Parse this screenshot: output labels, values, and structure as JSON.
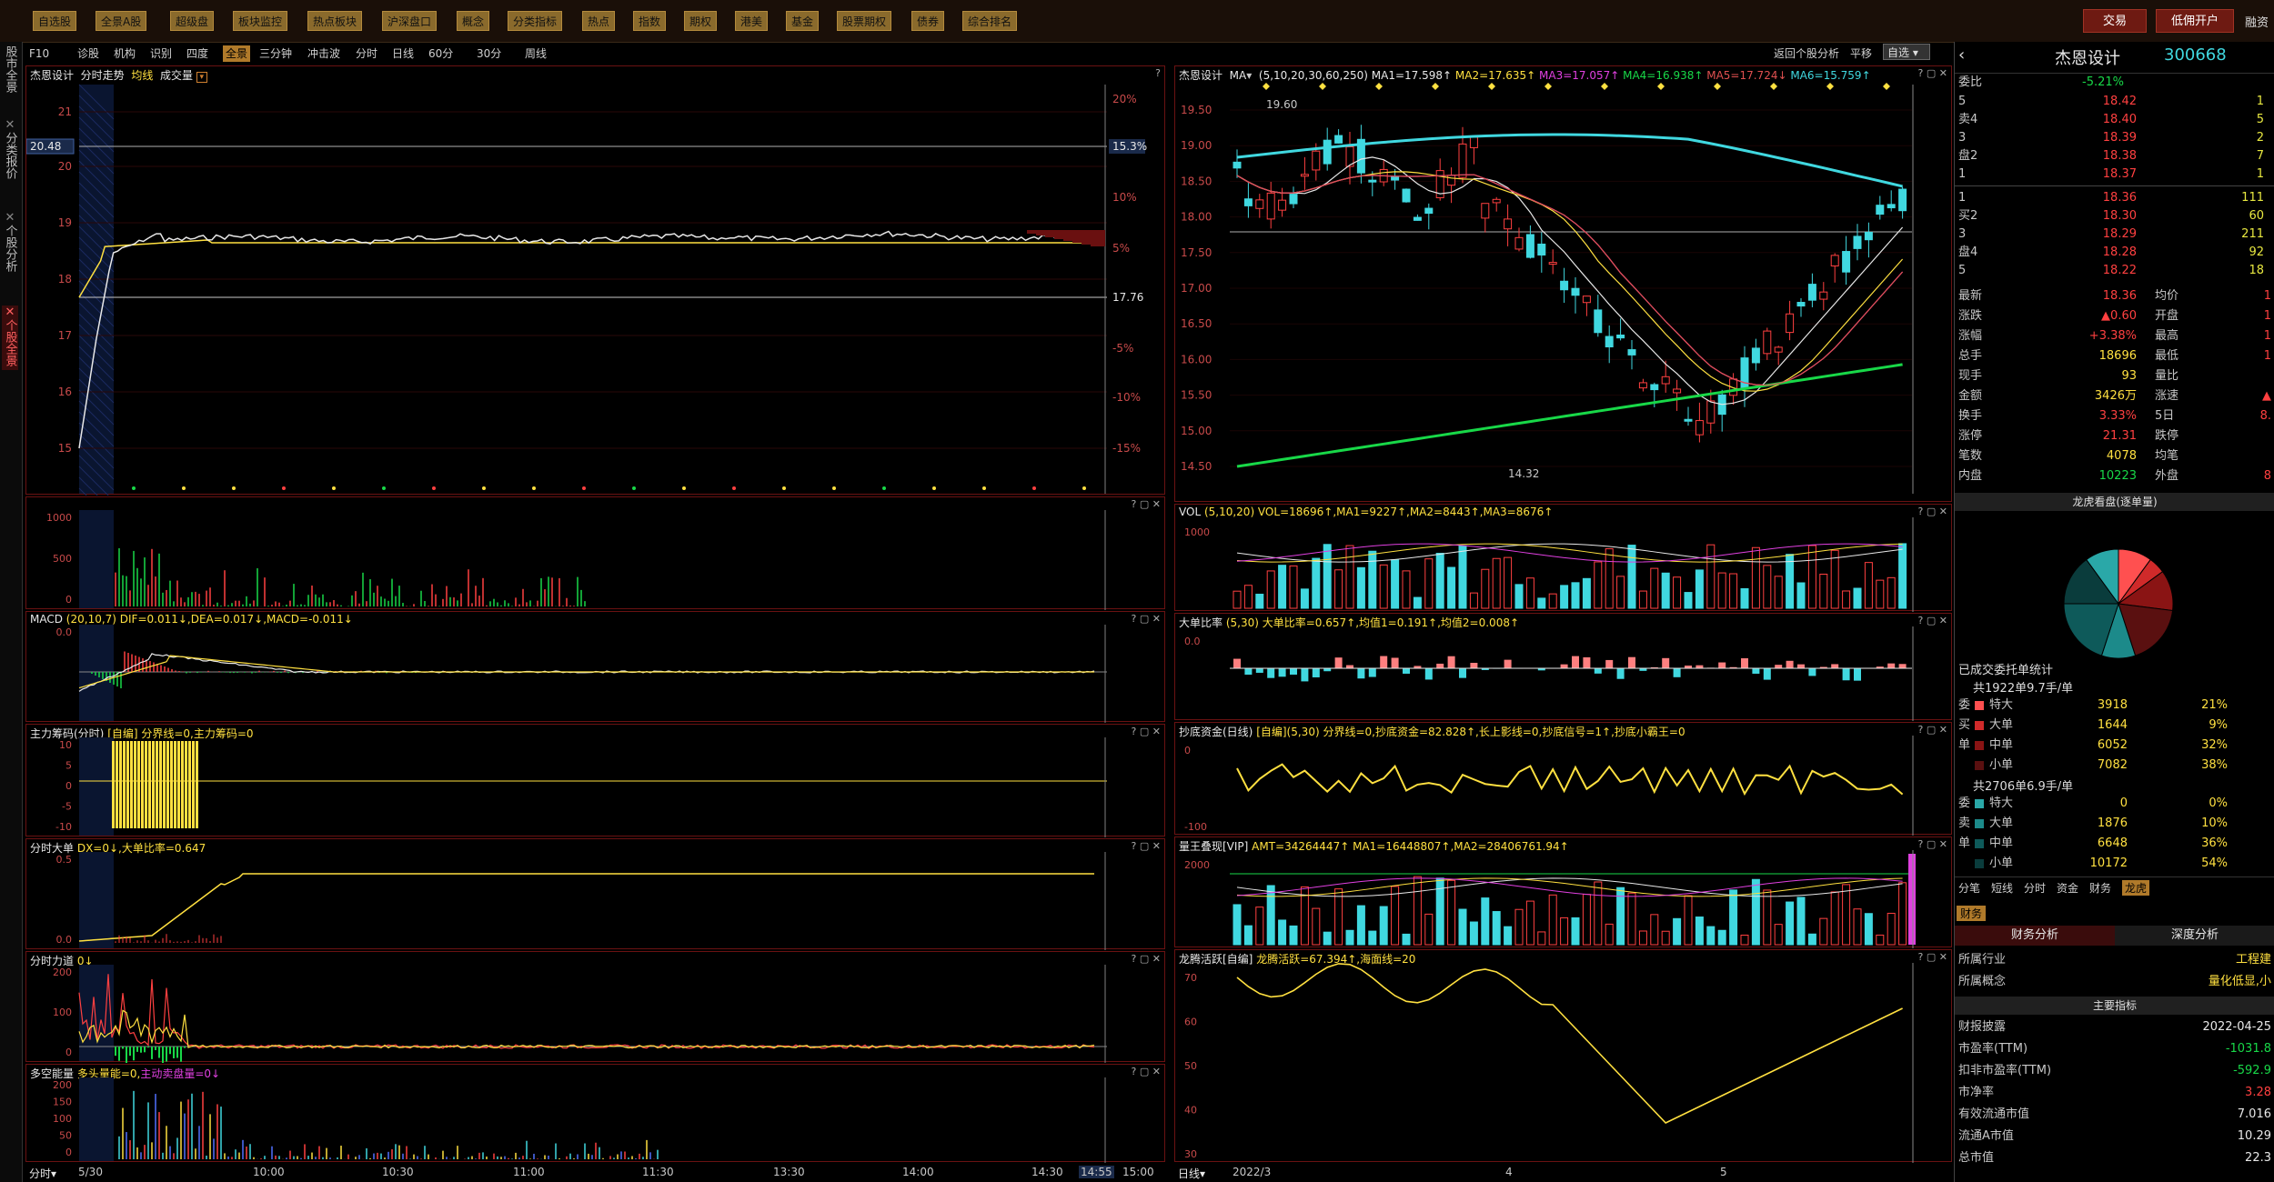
{
  "topbar": {
    "buttons": [
      "自选股",
      "全景A股",
      "超级盘",
      "板块监控",
      "热点板块",
      "沪深盘口",
      "概念",
      "分类指标",
      "热点",
      "指数",
      "期权",
      "港美",
      "基金",
      "股票期权",
      "债券",
      "综合排名"
    ],
    "trade_label": "交易",
    "open_account_label": "低佣开户",
    "misc": "融资"
  },
  "left_rail": [
    "股市全景",
    "分类报价",
    "个股分析",
    "个股全景"
  ],
  "toolbar": {
    "items": [
      "F10",
      "诊股",
      "机构",
      "识别",
      "四度",
      "全景",
      "三分钟",
      "冲击波",
      "分时",
      "日线",
      "60分",
      "30分",
      "周线"
    ],
    "active": "全景",
    "right": {
      "back": "返回个股分析",
      "flat": "平移",
      "watch": "自选"
    }
  },
  "intraday": {
    "title": "杰恩设计",
    "subtitle": "分时走势",
    "avg_label": "均线",
    "volume_label": "成交量",
    "yaxis": [
      "21",
      "20",
      "19",
      "18",
      "17",
      "16",
      "15"
    ],
    "pct_axis": [
      "20%",
      "15.3%",
      "10%",
      "5%",
      "17.76",
      "-5%",
      "-10%",
      "-15%"
    ],
    "price_marker": "20.48",
    "time_axis": [
      "5/30",
      "10:00",
      "10:30",
      "11:00",
      "11:30",
      "13:30",
      "14:00",
      "14:30",
      "14:55",
      "15:00"
    ],
    "footer_label": "分时",
    "subpanels": [
      {
        "title": "",
        "yaxis": [
          "1000",
          "500",
          "0"
        ]
      },
      {
        "title": "MACD",
        "info": "(20,10,7) DIF=0.011↓,DEA=0.017↓,MACD=-0.011↓",
        "yaxis": [
          "0.0"
        ]
      },
      {
        "title": "主力筹码(分时)",
        "info": "[自编] 分界线=0,主力筹码=0",
        "yaxis": [
          "10",
          "5",
          "0",
          "-5",
          "-10"
        ]
      },
      {
        "title": "分时大单",
        "info": "DX=0↓,大单比率=0.647",
        "yaxis": [
          "0.5",
          "0.0"
        ]
      },
      {
        "title": "分时力道",
        "info": "0↓",
        "yaxis": [
          "200",
          "100",
          "0"
        ]
      },
      {
        "title": "多空能量",
        "info": "多头量能=0,",
        "info2": "主动卖盘量=0↓",
        "yaxis": [
          "200",
          "150",
          "100",
          "50",
          "0"
        ]
      }
    ]
  },
  "daily": {
    "title": "杰恩设计",
    "ma_label": "MA",
    "ma_params": "(5,10,20,30,60,250)",
    "ma_values": [
      {
        "text": "MA1=17.598↑",
        "color": "#e8e8e8"
      },
      {
        "text": "MA2=17.635↑",
        "color": "#ffe040"
      },
      {
        "text": "MA3=17.057↑",
        "color": "#e040e0"
      },
      {
        "text": "MA4=16.938↑",
        "color": "#18d848"
      },
      {
        "text": "MA5=17.724↓",
        "color": "#e05050"
      },
      {
        "text": "MA6=15.759↑",
        "color": "#40d8e0"
      }
    ],
    "yaxis": [
      "19.50",
      "19.00",
      "18.50",
      "18.00",
      "17.50",
      "17.00",
      "16.50",
      "16.00",
      "15.50",
      "15.00",
      "14.50"
    ],
    "high_label": "19.60",
    "low_label": "14.32",
    "time_axis": [
      "2022/3",
      "4",
      "5"
    ],
    "footer_label": "日线",
    "subpanels": [
      {
        "title": "VOL",
        "info": "(5,10,20) VOL=18696↑,MA1=9227↑,MA2=8443↑,MA3=8676↑",
        "yaxis": [
          "1000"
        ]
      },
      {
        "title": "大单比率",
        "info": "(5,30) 大单比率=0.657↑,均值1=0.191↑,均值2=0.008↑",
        "yaxis": [
          "0.0"
        ]
      },
      {
        "title": "抄底资金(日线)",
        "info": "[自编](5,30) 分界线=0,抄底资金=82.828↑,长上影线=0,抄底信号=1↑,抄底小霸王=0",
        "yaxis": [
          "0",
          "-100"
        ]
      },
      {
        "title": "量王叠现[VIP]",
        "info": "AMT=34264447↑ MA1=16448807↑,MA2=28406761.94↑",
        "yaxis": [
          "2000"
        ]
      },
      {
        "title": "龙腾活跃[自编]",
        "info": "龙腾活跃=67.394↑,海面线=20",
        "yaxis": [
          "70",
          "60",
          "50",
          "40",
          "30"
        ]
      }
    ]
  },
  "quote": {
    "name": "杰恩设计",
    "code": "300668",
    "webi_label": "委比",
    "webi_value": "-5.21%",
    "asks": [
      {
        "label": "5",
        "price": "18.42",
        "vol": "1"
      },
      {
        "label": "卖4",
        "price": "18.40",
        "vol": "5"
      },
      {
        "label": "3",
        "price": "18.39",
        "vol": "2"
      },
      {
        "label": "盘2",
        "price": "18.38",
        "vol": "7"
      },
      {
        "label": "1",
        "price": "18.37",
        "vol": "1"
      }
    ],
    "bids": [
      {
        "label": "1",
        "price": "18.36",
        "vol": "111"
      },
      {
        "label": "买2",
        "price": "18.30",
        "vol": "60"
      },
      {
        "label": "3",
        "price": "18.29",
        "vol": "211"
      },
      {
        "label": "盘4",
        "price": "18.28",
        "vol": "92"
      },
      {
        "label": "5",
        "price": "18.22",
        "vol": "18"
      }
    ],
    "stats": [
      {
        "k1": "最新",
        "v1": "18.36",
        "k2": "均价",
        "v2": "1"
      },
      {
        "k1": "涨跌",
        "v1": "▲0.60",
        "k2": "开盘",
        "v2": "1"
      },
      {
        "k1": "涨幅",
        "v1": "+3.38%",
        "k2": "最高",
        "v2": "1"
      },
      {
        "k1": "总手",
        "v1": "18696",
        "k2": "最低",
        "v2": "1"
      },
      {
        "k1": "现手",
        "v1": "93",
        "k2": "量比",
        "v2": ""
      },
      {
        "k1": "金额",
        "v1": "3426万",
        "k2": "涨速",
        "v2": "▲"
      },
      {
        "k1": "换手",
        "v1": "3.33%",
        "k2": "5日",
        "v2": "8."
      },
      {
        "k1": "涨停",
        "v1": "21.31",
        "k2": "跌停",
        "v2": ""
      },
      {
        "k1": "笔数",
        "v1": "4078",
        "k2": "均笔",
        "v2": ""
      },
      {
        "k1": "内盘",
        "v1": "10223",
        "k2": "外盘",
        "v2": "8"
      }
    ],
    "lhb_title": "龙虎看盘(逐单量)",
    "deal_title": "已成交委托单统计",
    "buy_summary": "共1922单9.7手/单",
    "sell_summary": "共2706单6.9手/单",
    "buy_rows": [
      {
        "side": "委",
        "name": "特大",
        "vol": "3918",
        "pct": "21%"
      },
      {
        "side": "买",
        "name": "大单",
        "vol": "1644",
        "pct": "9%"
      },
      {
        "side": "单",
        "name": "中单",
        "vol": "6052",
        "pct": "32%"
      },
      {
        "side": "",
        "name": "小单",
        "vol": "7082",
        "pct": "38%"
      }
    ],
    "sell_rows": [
      {
        "side": "委",
        "name": "特大",
        "vol": "0",
        "pct": "0%"
      },
      {
        "side": "卖",
        "name": "大单",
        "vol": "1876",
        "pct": "10%"
      },
      {
        "side": "单",
        "name": "中单",
        "vol": "6648",
        "pct": "36%"
      },
      {
        "side": "",
        "name": "小单",
        "vol": "10172",
        "pct": "54%"
      }
    ],
    "tabs": [
      "分笔",
      "短线",
      "分时",
      "资金",
      "财务",
      "龙虎"
    ],
    "active_tab": "龙虎",
    "finance_tab": "财务",
    "fin_tabs": [
      "财务分析",
      "深度分析"
    ],
    "industry_label": "所属行业",
    "industry_value": "工程建",
    "concept_label": "所属概念",
    "concept_value": "量化低显,小",
    "main_index_label": "主要指标",
    "fin_rows": [
      {
        "k": "财报披露",
        "v": "2022-04-25",
        "c": "#e8e8e8"
      },
      {
        "k": "市盈率(TTM)",
        "v": "-1031.8",
        "c": "#18d848"
      },
      {
        "k": "扣非市盈率(TTM)",
        "v": "-592.9",
        "c": "#18d848"
      },
      {
        "k": "市净率",
        "v": "3.28",
        "c": "#ff4040"
      },
      {
        "k": "有效流通市值",
        "v": "7.016",
        "c": "#e8e8e8"
      },
      {
        "k": "流通A市值",
        "v": "10.29",
        "c": "#e8e8e8"
      },
      {
        "k": "总市值",
        "v": "22.3",
        "c": "#e8e8e8"
      }
    ],
    "pie_colors": [
      "#ff5050",
      "#d02a2a",
      "#8a1414",
      "#5a1010",
      "#1c8a8a",
      "#0e5a5a",
      "#0a3c3c",
      "#2aa8a8"
    ]
  }
}
